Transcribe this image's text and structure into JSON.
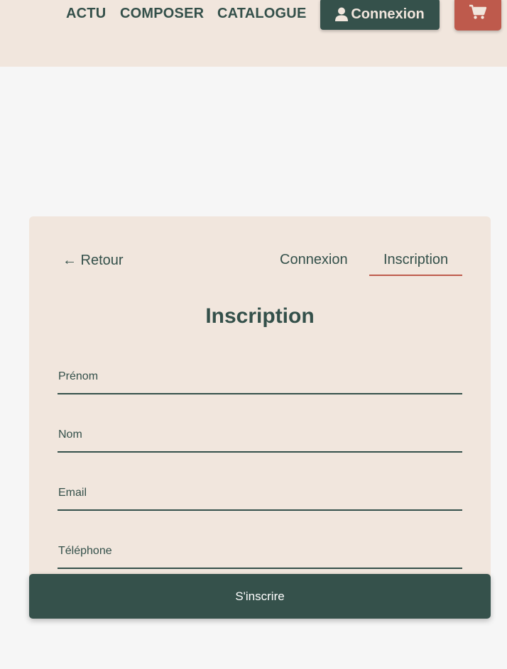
{
  "header": {
    "nav": {
      "actu": "ACTU",
      "composer": "COMPOSER",
      "catalogue": "CATALOGUE"
    },
    "login_label": "Connexion",
    "login_icon": "user-icon",
    "cart_icon": "shopping-cart-icon"
  },
  "card": {
    "back_label": "← Retour",
    "tabs": [
      {
        "label": "Connexion",
        "active": false
      },
      {
        "label": "Inscription",
        "active": true
      }
    ],
    "title": "Inscription",
    "fields": [
      {
        "label": "Prénom",
        "value": ""
      },
      {
        "label": "Nom",
        "value": ""
      },
      {
        "label": "Email",
        "value": ""
      },
      {
        "label": "Téléphone",
        "value": ""
      }
    ],
    "submit_label": "S'inscrire"
  },
  "colors": {
    "primary": "#35514b",
    "accent": "#be5a4c",
    "cream": "#f1e6dd",
    "background": "#f6f6f6"
  }
}
